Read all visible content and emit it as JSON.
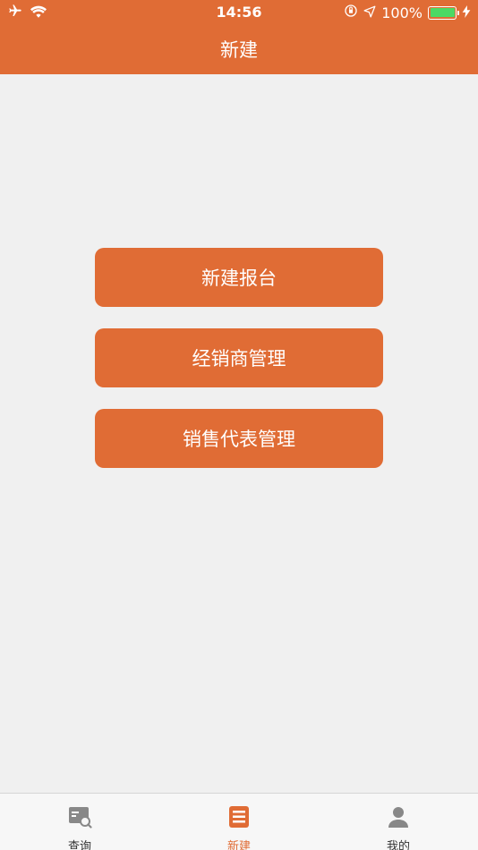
{
  "status_bar": {
    "time": "14:56",
    "battery": "100%",
    "icons": [
      "airplane-icon",
      "wifi-icon",
      "orientation-lock-icon",
      "location-arrow-icon",
      "battery-icon",
      "charging-bolt-icon"
    ]
  },
  "header": {
    "title": "新建"
  },
  "menu": {
    "buttons": [
      "新建报台",
      "经销商管理",
      "销售代表管理"
    ]
  },
  "tabbar": {
    "tabs": [
      {
        "label": "查询",
        "icon": "search-doc-icon"
      },
      {
        "label": "新建",
        "icon": "list-doc-icon",
        "active": true
      },
      {
        "label": "我的",
        "icon": "person-icon"
      }
    ]
  },
  "colors": {
    "accent": "#e06c35",
    "background": "#f0f0f0",
    "tab_inactive": "#333333"
  }
}
